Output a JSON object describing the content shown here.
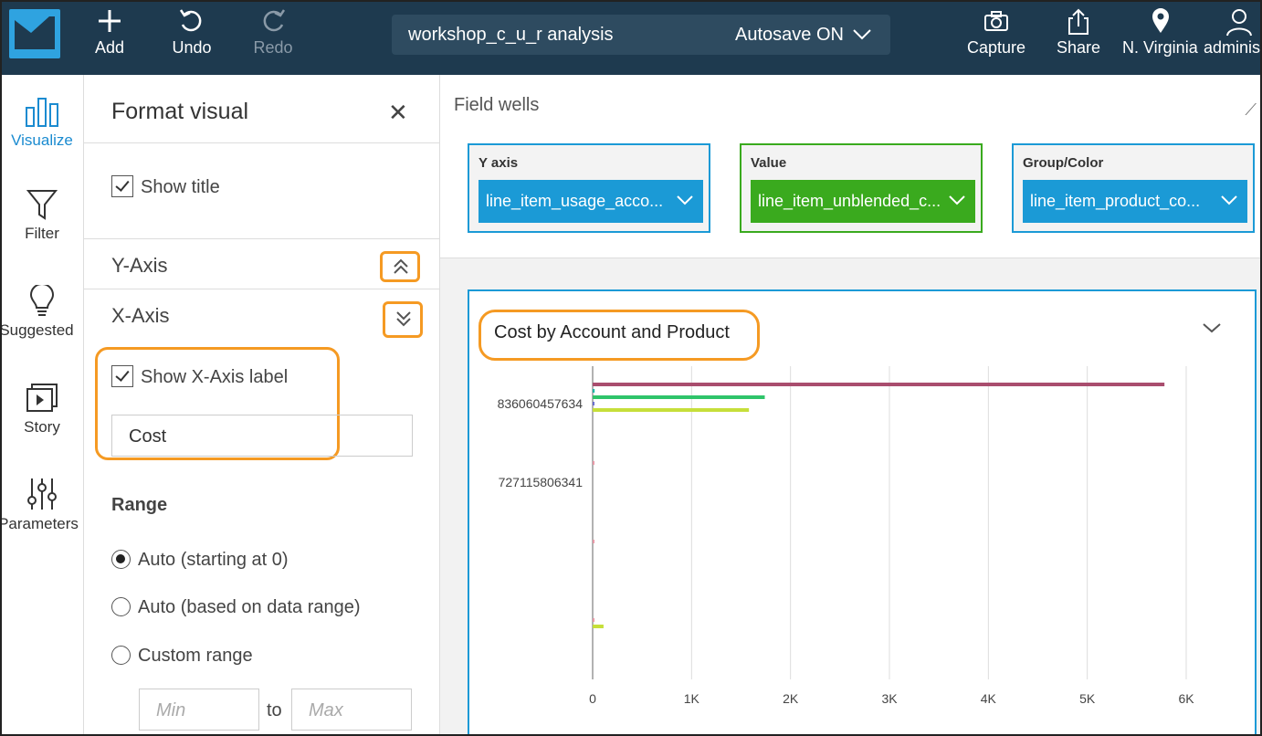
{
  "topbar": {
    "add": "Add",
    "undo": "Undo",
    "redo": "Redo",
    "analysis_name": "workshop_c_u_r analysis",
    "autosave": "Autosave ON",
    "capture": "Capture",
    "share": "Share",
    "region": "N. Virginia",
    "user": "administ"
  },
  "rail": {
    "visualize": "Visualize",
    "filter": "Filter",
    "suggested": "Suggested",
    "story": "Story",
    "parameters": "Parameters"
  },
  "panel": {
    "title": "Format visual",
    "show_title": "Show title",
    "y_axis": "Y-Axis",
    "x_axis": "X-Axis",
    "show_x_axis_label": "Show X-Axis label",
    "x_axis_label_value": "Cost",
    "range": "Range",
    "auto_zero": "Auto (starting at 0)",
    "auto_data": "Auto (based on data range)",
    "custom": "Custom range",
    "min_placeholder": "Min",
    "to": "to",
    "max_placeholder": "Max"
  },
  "fieldwells": {
    "title": "Field wells",
    "y_axis_label": "Y axis",
    "y_axis_field": "line_item_usage_acco...",
    "value_label": "Value",
    "value_field": "line_item_unblended_c...",
    "group_label": "Group/Color",
    "group_field": "line_item_product_co..."
  },
  "visual": {
    "title": "Cost by Account and Product"
  },
  "colors": {
    "accent": "#1b9ad6",
    "value_well": "#3aaa1e",
    "highlight": "#f59a23",
    "topbar": "#1e3a4f"
  },
  "chart_data": {
    "type": "bar",
    "orientation": "horizontal",
    "categories": [
      "836060457634",
      "727115806341"
    ],
    "x_ticks": [
      "0",
      "1K",
      "2K",
      "3K",
      "4K",
      "5K",
      "6K"
    ],
    "xlim": [
      0,
      6000
    ],
    "bars": [
      {
        "category_index": 0,
        "value": 5780,
        "color": "#a94d6e"
      },
      {
        "category_index": 0,
        "value": 20,
        "color": "#1fb8a6"
      },
      {
        "category_index": 0,
        "value": 1740,
        "color": "#2fc46a"
      },
      {
        "category_index": 0,
        "value": 15,
        "color": "#6a6fd0"
      },
      {
        "category_index": 0,
        "value": 1580,
        "color": "#c6df3a"
      },
      {
        "category_index": 1,
        "value": 10,
        "color": "#e89aa8"
      },
      {
        "category_index": 2,
        "value": 10,
        "color": "#e89aa8"
      },
      {
        "category_index": 3,
        "value": 8,
        "color": "#e89aa8"
      },
      {
        "category_index": 3,
        "value": 110,
        "color": "#c6df3a"
      }
    ],
    "grid": true,
    "legend": "none"
  }
}
